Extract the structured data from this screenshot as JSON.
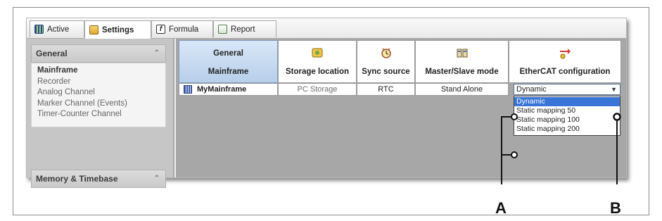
{
  "tabs": [
    {
      "label": "Active",
      "icon": "grid-icon"
    },
    {
      "label": "Settings",
      "icon": "settings-icon"
    },
    {
      "label": "Formula",
      "icon": "formula-icon"
    },
    {
      "label": "Report",
      "icon": "report-icon"
    }
  ],
  "sidebar": {
    "groups": [
      {
        "title": "General",
        "items": [
          "Mainframe",
          "Recorder",
          "Analog Channel",
          "Marker Channel (Events)",
          "Timer-Counter Channel"
        ],
        "selected": "Mainframe"
      },
      {
        "title": "Memory & Timebase"
      }
    ]
  },
  "grid": {
    "header_general_top": "General",
    "header_general_bottom": "Mainframe",
    "columns": [
      {
        "label": "Storage location",
        "icon": "storage-icon"
      },
      {
        "label": "Sync source",
        "icon": "clock-icon"
      },
      {
        "label": "Master/Slave mode",
        "icon": "master-slave-icon"
      },
      {
        "label": "EtherCAT configuration",
        "icon": "ethercat-icon"
      }
    ],
    "row": {
      "name": "MyMainframe",
      "storage": "PC Storage",
      "sync": "RTC",
      "mode": "Stand Alone",
      "ethercat": "Dynamic"
    }
  },
  "dropdown": {
    "options": [
      "Dynamic",
      "Static mapping 50",
      "Static mapping 100",
      "Static mapping 200"
    ],
    "highlighted": "Dynamic"
  },
  "callouts": {
    "a": "A",
    "b": "B"
  },
  "colors": {
    "accent": "#3875d7",
    "header_blue": "#b7cfea"
  }
}
